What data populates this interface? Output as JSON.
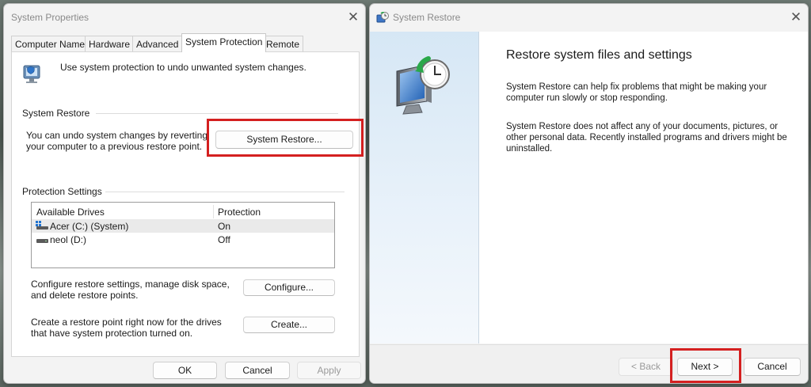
{
  "system_properties": {
    "title": "System Properties",
    "tabs": [
      {
        "label": "Computer Name"
      },
      {
        "label": "Hardware"
      },
      {
        "label": "Advanced"
      },
      {
        "label": "System Protection"
      },
      {
        "label": "Remote"
      }
    ],
    "intro_text": "Use system protection to undo unwanted system changes.",
    "system_restore_section": {
      "heading": "System Restore",
      "description": "You can undo system changes by reverting your computer to a previous restore point.",
      "button_label": "System Restore..."
    },
    "protection_settings": {
      "heading": "Protection Settings",
      "columns": [
        "Available Drives",
        "Protection"
      ],
      "rows": [
        {
          "drive": "Acer (C:) (System)",
          "protection": "On"
        },
        {
          "drive": "neol (D:)",
          "protection": "Off"
        }
      ],
      "configure_text": "Configure restore settings, manage disk space, and delete restore points.",
      "configure_button": "Configure...",
      "create_text": "Create a restore point right now for the drives that have system protection turned on.",
      "create_button": "Create..."
    },
    "buttons": {
      "ok": "OK",
      "cancel": "Cancel",
      "apply": "Apply"
    }
  },
  "system_restore": {
    "title": "System Restore",
    "heading": "Restore system files and settings",
    "paragraph1": "System Restore can help fix problems that might be making your computer run slowly or stop responding.",
    "paragraph2": "System Restore does not affect any of your documents, pictures, or other personal data. Recently installed programs and drivers might be uninstalled.",
    "buttons": {
      "back": "< Back",
      "next": "Next >",
      "cancel": "Cancel"
    }
  },
  "colors": {
    "highlight": "#d42020",
    "selected_row": "#eaeaea"
  },
  "icons": [
    "system-protection-icon",
    "system-restore-icon",
    "system-restore-hero-icon",
    "system-drive-icon",
    "drive-icon",
    "close-icon"
  ]
}
